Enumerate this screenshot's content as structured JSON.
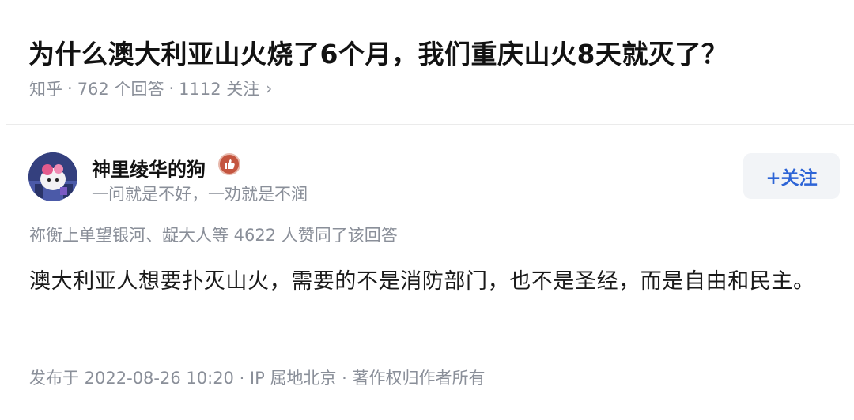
{
  "question": {
    "title": "为什么澳大利亚山火烧了6个月，我们重庆山火8天就灭了？",
    "source": "知乎",
    "answers": "762 个回答",
    "followers": "1112 关注",
    "chevron": "›"
  },
  "author": {
    "name": "神里绫华的狗",
    "headline": "一问就是不好，一劝就是不润",
    "badge_icon": "thumbs-up-badge-icon",
    "follow_label": "+关注"
  },
  "answer": {
    "voters": "祢衡上单望银河、龊大人等 4622 人赞同了该回答",
    "content": "澳大利亚人想要扑灭山火，需要的不是消防部门，也不是圣经，而是自由和民主。",
    "footer": "发布于 2022-08-26 10:20 · IP 属地北京 · 著作权归作者所有"
  },
  "colors": {
    "accent": "#2d64d6",
    "muted_text": "#8a8f99",
    "badge": "#c4553f"
  }
}
